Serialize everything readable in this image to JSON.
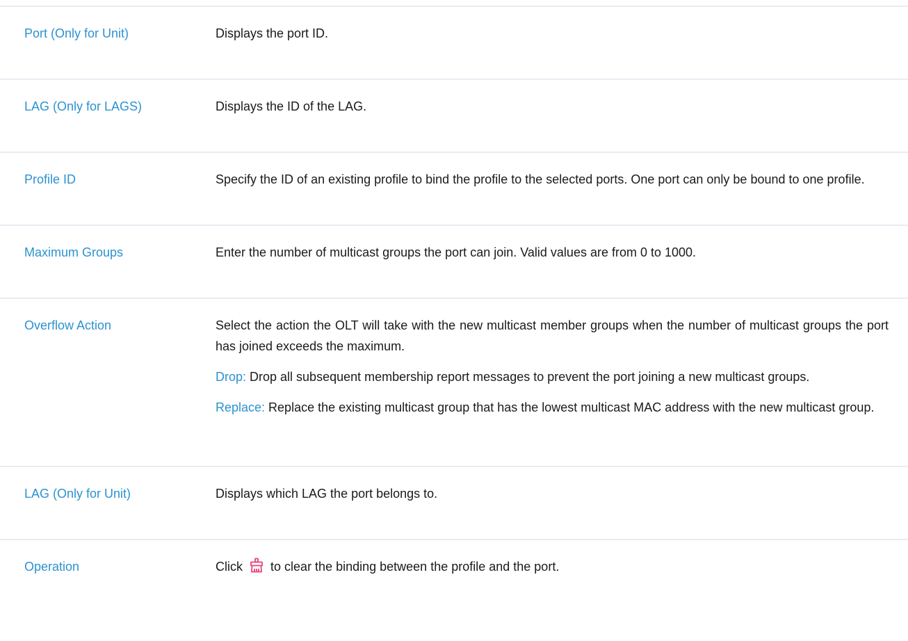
{
  "rows": [
    {
      "term": "Port (Only for Unit)",
      "desc": "Displays the port ID."
    },
    {
      "term": "LAG (Only for LAGS)",
      "desc": "Displays the ID of the LAG."
    },
    {
      "term": "Profile ID",
      "desc": "Specify the ID of an existing profile to bind the profile to the selected ports. One port can only be bound to one profile."
    },
    {
      "term": "Maximum Groups",
      "desc": "Enter the number of multicast groups the port can join. Valid values are from  0 to 1000."
    },
    {
      "term": "Overflow Action",
      "desc": "Select the action the OLT will take with the new multicast member groups when the number of multicast groups the port has joined exceeds the maximum.",
      "drop_label": "Drop:",
      "drop_text": " Drop all subsequent membership report messages to prevent the port joining a new multicast groups.",
      "replace_label": "Replace:",
      "replace_text": " Replace the existing multicast group that has the lowest multicast MAC address with the new multicast group."
    },
    {
      "term": "LAG (Only for Unit)",
      "desc": "Displays which LAG the port belongs to."
    },
    {
      "term": "Operation",
      "desc_before": "Click",
      "icon": "clear-binding-icon",
      "desc_after": "to clear the binding between the profile and the port."
    }
  ],
  "colors": {
    "term": "#2c92d0",
    "divider": "#e6edf3",
    "icon": "#e8417a"
  }
}
